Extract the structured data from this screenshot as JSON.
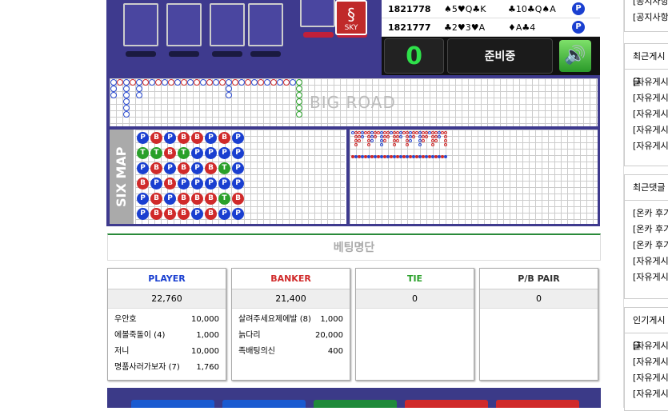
{
  "history": [
    {
      "id": "1821778",
      "player": "♠5♥Q♣K",
      "banker": "♣10♣Q♠A",
      "result": "P"
    },
    {
      "id": "1821777",
      "player": "♣2♥3♥A",
      "banker": "♦A♣4",
      "result": "P"
    }
  ],
  "control": {
    "count": "0",
    "status": "준비중"
  },
  "bigroad_label": "BIG ROAD",
  "sixmap_label": "SIX MAP",
  "deck_label": "SKY",
  "betlist_title": "베팅명단",
  "colors": {
    "player": "#1a3fd0",
    "banker": "#d02a2a",
    "tie": "#2aa02a"
  },
  "sixmap": [
    [
      "P",
      "B",
      "P",
      "B",
      "B",
      "P",
      "B",
      "P"
    ],
    [
      "T",
      "T",
      "B",
      "T",
      "P",
      "P",
      "P",
      "P"
    ],
    [
      "P",
      "B",
      "P",
      "B",
      "P",
      "B",
      "T",
      "P"
    ],
    [
      "B",
      "P",
      "B",
      "P",
      "P",
      "P",
      "P",
      "P"
    ],
    [
      "P",
      "B",
      "P",
      "B",
      "B",
      "B",
      "T",
      "B"
    ],
    [
      "P",
      "B",
      "B",
      "B",
      "P",
      "B",
      "P",
      "P"
    ]
  ],
  "panels": [
    {
      "title": "PLAYER",
      "total": "22,760",
      "rows": [
        {
          "name": "우안호",
          "amount": "10,000"
        },
        {
          "name": "에볼죽돌이 (4)",
          "amount": "1,000"
        },
        {
          "name": "저니",
          "amount": "10,000"
        },
        {
          "name": "명품사러가보자 (7)",
          "amount": "1,760"
        }
      ]
    },
    {
      "title": "BANKER",
      "total": "21,400",
      "rows": [
        {
          "name": "살려주세요제에발 (8)",
          "amount": "1,000"
        },
        {
          "name": "늙다리",
          "amount": "20,000"
        },
        {
          "name": "족배팅의신",
          "amount": "400"
        }
      ]
    },
    {
      "title": "TIE",
      "total": "0",
      "rows": []
    },
    {
      "title": "P/B PAIR",
      "total": "0",
      "rows": []
    }
  ],
  "sidebar": {
    "notice_items": [
      "[공지사항",
      "[공지사항"
    ],
    "recent_posts_title": "최근게시글",
    "recent_posts": [
      "[자유게시",
      "[자유게시",
      "[자유게시",
      "[자유게시",
      "[자유게시"
    ],
    "recent_comments_title": "최근댓글",
    "recent_comments": [
      "[온카 후기",
      "[온카 후기",
      "[온카 후기",
      "[자유게시",
      "[자유게시"
    ],
    "popular_title": "인기게시글",
    "popular_posts": [
      "[자유게시",
      "[자유게시",
      "[자유게시",
      "[자유게시"
    ]
  }
}
